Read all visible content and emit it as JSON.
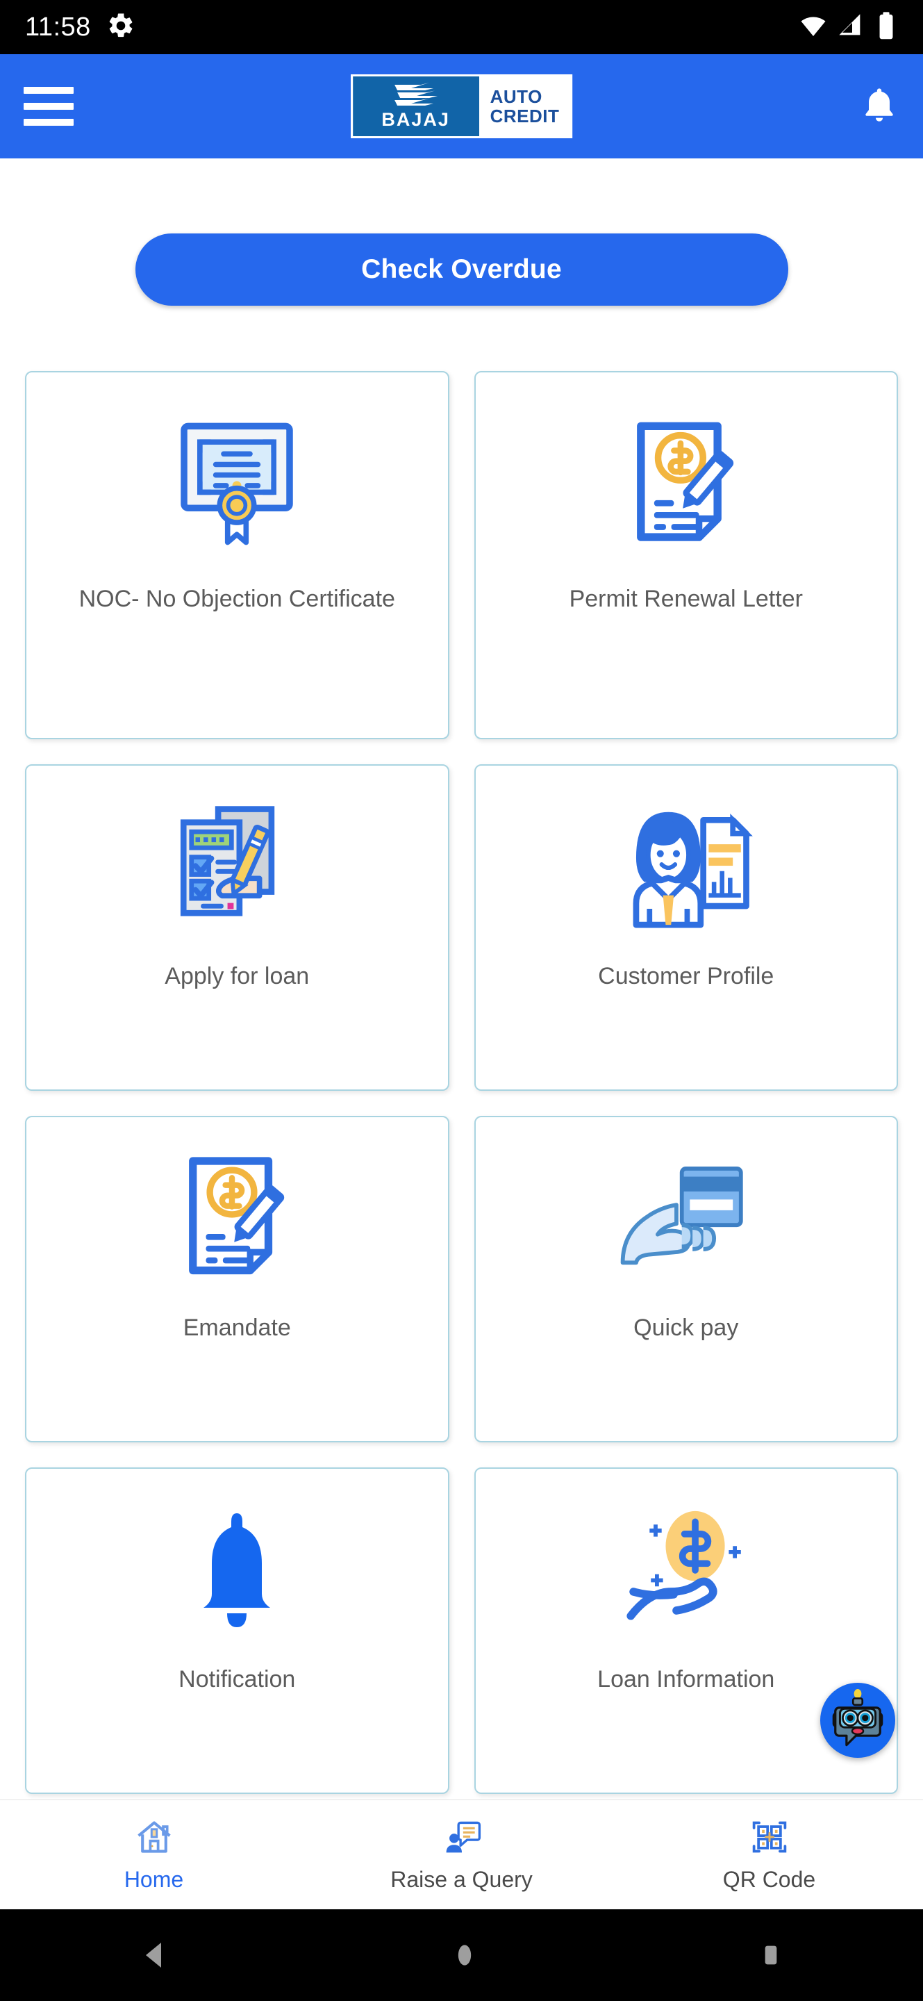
{
  "statusbar": {
    "clock": "11:58",
    "icons": [
      "gear-icon",
      "wifi-icon",
      "cellular-signal-icon",
      "battery-icon"
    ]
  },
  "header": {
    "menu_icon": "hamburger-menu-icon",
    "logo": {
      "brand": "BAJAJ",
      "product_line1": "AUTO",
      "product_line2": "CREDIT"
    },
    "notification_icon": "bell-icon"
  },
  "main": {
    "cta_label": "Check Overdue",
    "tiles": [
      {
        "label": "NOC- No Objection Certificate",
        "icon": "certificate-icon"
      },
      {
        "label": "Permit Renewal Letter",
        "icon": "document-sign-icon"
      },
      {
        "label": "Apply for loan",
        "icon": "form-checklist-hand-icon"
      },
      {
        "label": "Customer Profile",
        "icon": "person-profile-icon"
      },
      {
        "label": "Emandate",
        "icon": "document-sign-icon"
      },
      {
        "label": "Quick pay",
        "icon": "hand-credit-card-icon"
      },
      {
        "label": "Notification",
        "icon": "bell-icon"
      },
      {
        "label": "Loan Information",
        "icon": "hand-coin-icon"
      }
    ],
    "chat_fab_icon": "chatbot-robot-icon"
  },
  "bottom_nav": {
    "items": [
      {
        "label": "Home",
        "icon": "home-icon",
        "active": true
      },
      {
        "label": "Raise a Query",
        "icon": "query-chat-icon",
        "active": false
      },
      {
        "label": "QR Code",
        "icon": "qr-code-icon",
        "active": false
      }
    ]
  },
  "system_nav": {
    "back": "back-triangle-icon",
    "home": "home-circle-icon",
    "recents": "recents-square-icon"
  },
  "colors": {
    "primary_blue": "#2668ED",
    "logo_blue": "#1164A8",
    "card_border": "#a9d4e1",
    "accent_yellow": "#F6C košt"
  }
}
